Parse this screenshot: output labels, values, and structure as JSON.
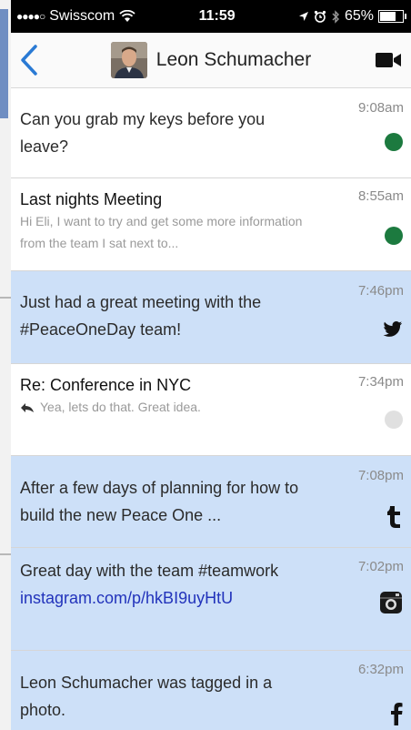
{
  "status_bar": {
    "carrier": "Swisscom",
    "time": "11:59",
    "battery": "65%",
    "battery_level": 0.65
  },
  "header": {
    "contact_name": "Leon Schumacher",
    "icons": {
      "back": "chevron-left-icon",
      "video": "video-camera-icon",
      "avatar": "contact-photo"
    }
  },
  "colors": {
    "accent_blue": "#2a7ad4",
    "highlight_row": "#cde0f8",
    "status_green": "#1c7a3f",
    "status_grey": "#e0e0e0",
    "link": "#2233bb"
  },
  "messages": [
    {
      "text": "Can you grab my keys before you leave?",
      "time": "9:08am",
      "badge": "green-dot"
    },
    {
      "title": "Last nights Meeting",
      "preview": "Hi Eli, I want to try and get some more information from the team I sat next to...",
      "time": "8:55am",
      "badge": "green-dot"
    },
    {
      "text": "Just had a great meeting with the #PeaceOneDay team!",
      "time": "7:46pm",
      "badge": "twitter-icon"
    },
    {
      "title": "Re: Conference in NYC",
      "preview": "Yea, lets do that.  Great idea.",
      "time": "7:34pm",
      "badge": "grey-dot"
    },
    {
      "text": "After a few days of planning for how to build the new Peace One ...",
      "time": "7:08pm",
      "badge": "tumblr-icon"
    },
    {
      "text": "Great day with the team #teamwork",
      "link": "instagram.com/p/hkBI9uyHtU",
      "time": "7:02pm",
      "badge": "instagram-icon"
    },
    {
      "text": "Leon Schumacher was tagged in a photo.",
      "time": "6:32pm",
      "badge": "facebook-icon"
    }
  ]
}
